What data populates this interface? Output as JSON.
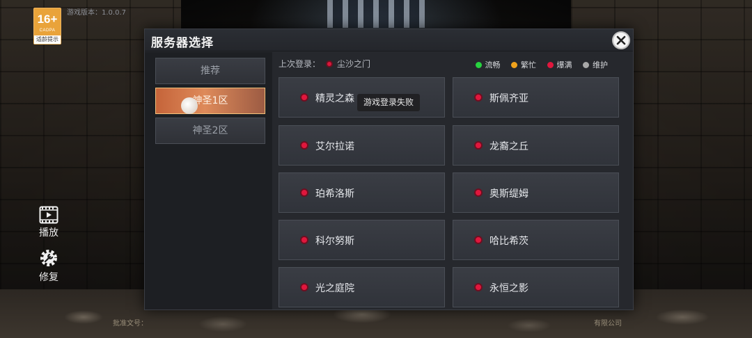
{
  "top_info": {
    "age_rating": "16+",
    "age_org": "CADPA",
    "age_tip": "适龄提示",
    "version": "游戏版本：1.0.0.7"
  },
  "tools": {
    "play_label": "播放",
    "repair_label": "修复"
  },
  "footer": {
    "approval_prefix": "批准文号：",
    "company_suffix": "有限公司"
  },
  "dialog": {
    "title": "服务器选择",
    "categories": [
      {
        "label": "推荐",
        "active": false
      },
      {
        "label": "神圣1区",
        "active": true
      },
      {
        "label": "神圣2区",
        "active": false
      }
    ],
    "last_login": {
      "label": "上次登录：",
      "server": "尘沙之门"
    },
    "legend": [
      {
        "label": "流畅",
        "color": "#27d33f"
      },
      {
        "label": "繁忙",
        "color": "#f0a21c"
      },
      {
        "label": "爆满",
        "color": "#e0173d"
      },
      {
        "label": "维护",
        "color": "#a8a8a8"
      }
    ],
    "servers": [
      {
        "name": "精灵之森",
        "status": "爆满"
      },
      {
        "name": "斯佩齐亚",
        "status": "爆满"
      },
      {
        "name": "艾尔拉诺",
        "status": "爆满"
      },
      {
        "name": "龙裔之丘",
        "status": "爆满"
      },
      {
        "name": "珀希洛斯",
        "status": "爆满"
      },
      {
        "name": "奥斯缇姆",
        "status": "爆满"
      },
      {
        "name": "科尔努斯",
        "status": "爆满"
      },
      {
        "name": "哈比希茨",
        "status": "爆满"
      },
      {
        "name": "光之庭院",
        "status": "爆满"
      },
      {
        "name": "永恒之影",
        "status": "爆满"
      }
    ]
  },
  "toast": {
    "message": "游戏登录失败"
  }
}
